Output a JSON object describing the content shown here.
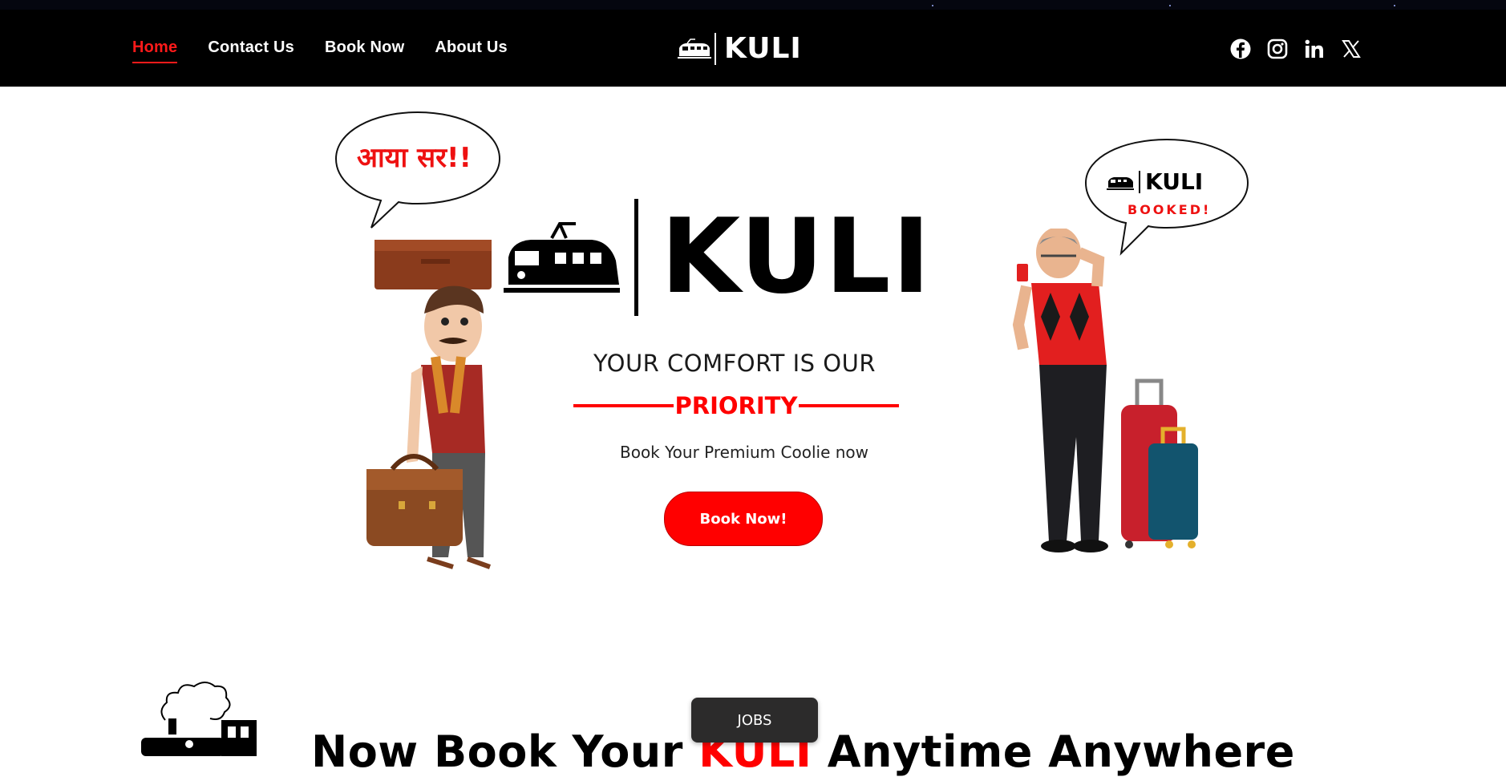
{
  "nav": {
    "links": [
      "Home",
      "Contact Us",
      "Book Now",
      "About Us"
    ],
    "active": "Home",
    "logo_text": "KULI",
    "socials": [
      "facebook-icon",
      "instagram-icon",
      "linkedin-icon",
      "x-icon"
    ]
  },
  "hero": {
    "logo_text": "KULI",
    "tagline": "YOUR COMFORT IS OUR",
    "priority": "PRIORITY",
    "subtext": "Book Your Premium Coolie now",
    "cta_label": "Book Now!",
    "bubble_left_text": "आया सर!!",
    "bubble_right_brand": "KULI",
    "bubble_right_status": "BOOKED!"
  },
  "section": {
    "headline_part1": "Now Book Your ",
    "headline_accent": "KULI",
    "headline_part2": " Anytime Anywhere"
  },
  "floating": {
    "jobs_label": "JOBS"
  },
  "colors": {
    "accent": "#ff0000",
    "nav_bg": "#000000",
    "page_bg": "#ffffff",
    "jobs_bg": "#2c2b2b"
  }
}
